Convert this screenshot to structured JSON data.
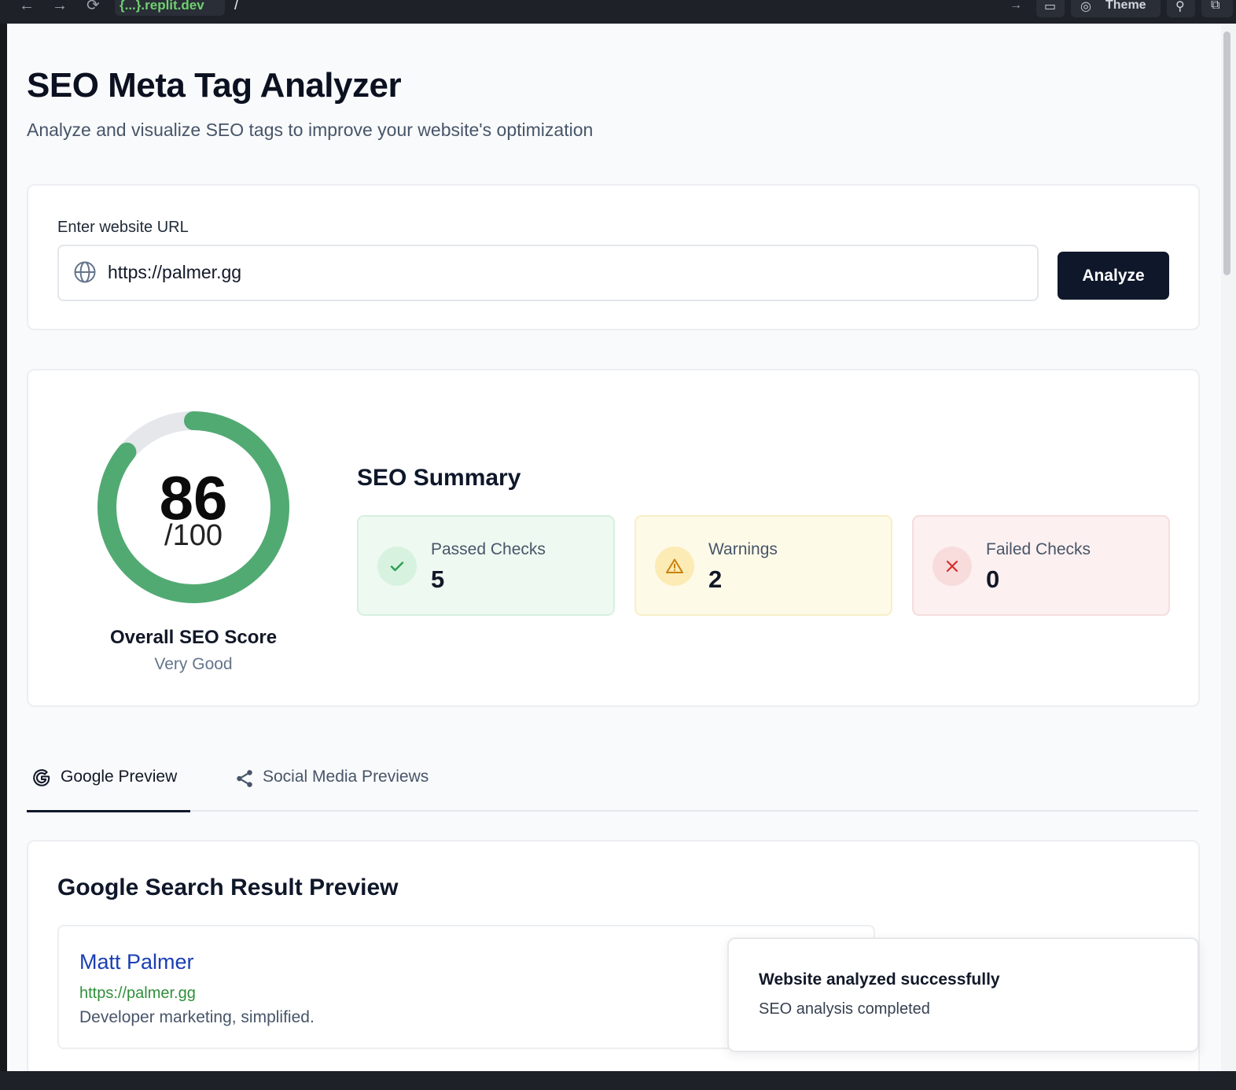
{
  "browser": {
    "url_host": "{...}.replit.dev",
    "url_path": "/",
    "theme_label": "Theme"
  },
  "header": {
    "title": "SEO Meta Tag Analyzer",
    "subtitle": "Analyze and visualize SEO tags to improve your website's optimization"
  },
  "url_form": {
    "label": "Enter website URL",
    "value": "https://palmer.gg",
    "button_label": "Analyze"
  },
  "score": {
    "value": "86",
    "max_label": "/100",
    "fraction": 0.86,
    "label": "Overall SEO Score",
    "rating": "Very Good",
    "color": "#52aa73",
    "track_color": "#e5e7eb"
  },
  "summary": {
    "title": "SEO Summary",
    "items": [
      {
        "label": "Passed Checks",
        "value": "5",
        "icon": "check-icon",
        "bg": "#eef9f1",
        "border": "#d8f0df",
        "icon_bg": "#d7f3df",
        "icon_color": "#2f9e55"
      },
      {
        "label": "Warnings",
        "value": "2",
        "icon": "warning-icon",
        "bg": "#fefae8",
        "border": "#f7efc7",
        "icon_bg": "#fcebb4",
        "icon_color": "#c9820c"
      },
      {
        "label": "Failed Checks",
        "value": "0",
        "icon": "x-icon",
        "bg": "#fcf0f0",
        "border": "#f6dddd",
        "icon_bg": "#f8dcdc",
        "icon_color": "#d92b2b"
      }
    ]
  },
  "tabs": [
    {
      "label": "Google Preview",
      "icon": "google-icon",
      "active": true
    },
    {
      "label": "Social Media Previews",
      "icon": "share-icon",
      "active": false
    }
  ],
  "google_preview": {
    "title": "Google Search Result Preview",
    "result_title": "Matt Palmer",
    "result_url": "https://palmer.gg",
    "result_description": "Developer marketing, simplified."
  },
  "toast": {
    "title": "Website analyzed successfully",
    "description": "SEO analysis completed"
  }
}
